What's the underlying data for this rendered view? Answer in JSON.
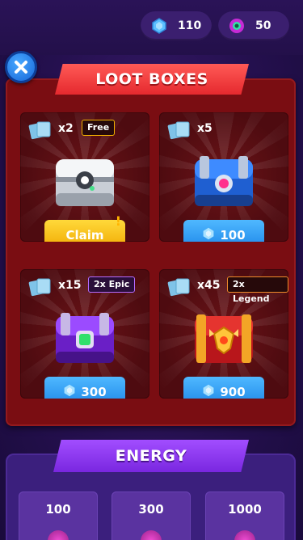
{
  "currencies": {
    "gems": {
      "value": "110",
      "icon": "gem-icon"
    },
    "energy": {
      "value": "50",
      "icon": "energy-orb-icon"
    }
  },
  "loot_boxes": {
    "title": "LOOT BOXES",
    "items": [
      {
        "count": "x2",
        "tag": "Free",
        "button": "Claim",
        "chest": "silver-chest"
      },
      {
        "count": "x5",
        "tag": "",
        "button": "100",
        "chest": "blue-chest"
      },
      {
        "count": "x15",
        "tag": "2x Epic",
        "button": "300",
        "chest": "purple-chest"
      },
      {
        "count": "x45",
        "tag": "2x Legend",
        "button": "900",
        "chest": "legend-chest"
      }
    ]
  },
  "energy": {
    "title": "ENERGY",
    "packs": [
      "100",
      "300",
      "1000"
    ]
  },
  "colors": {
    "panel_red": "#7a0d12",
    "ribbon_red": "#e5292e",
    "button_blue": "#1c86e8",
    "button_yellow": "#f0a800",
    "energy_purple": "#7a27e0"
  }
}
